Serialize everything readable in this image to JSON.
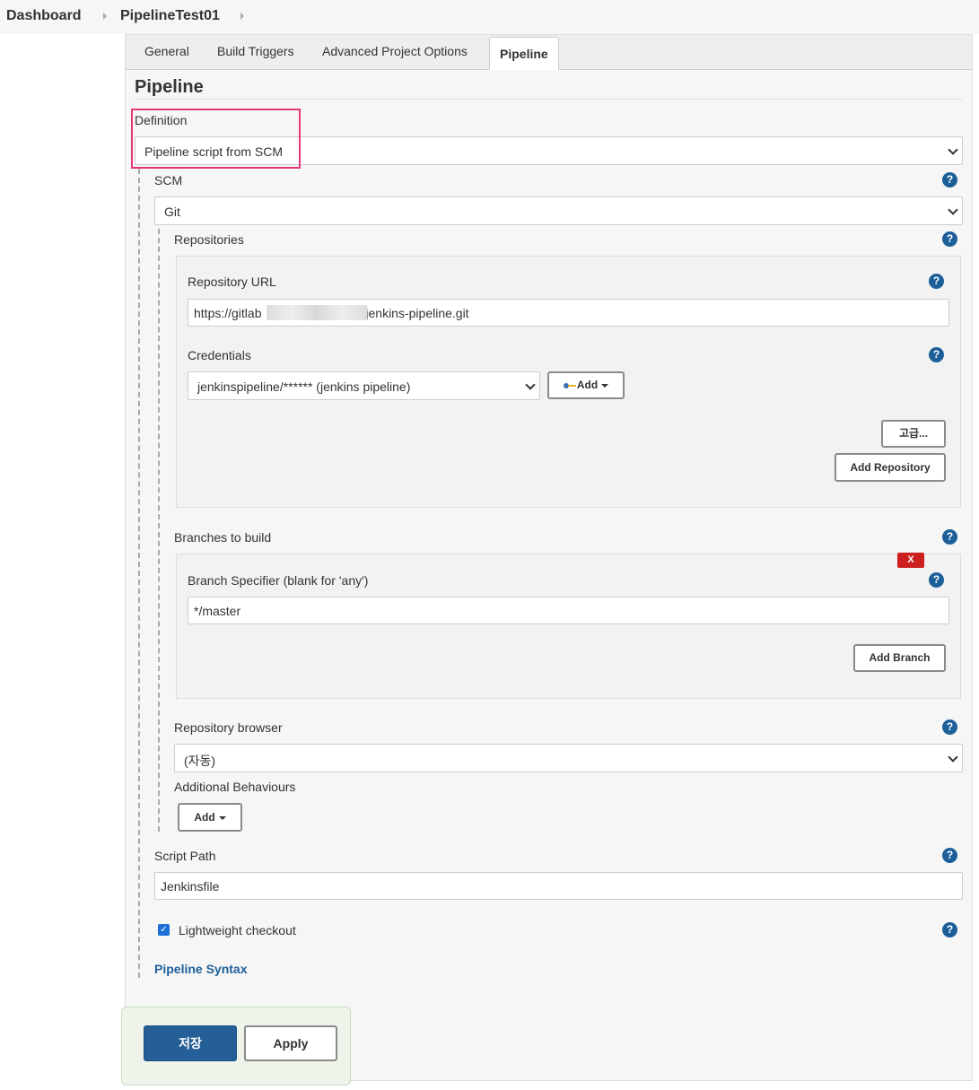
{
  "breadcrumb": {
    "items": [
      "Dashboard",
      "PipelineTest01"
    ]
  },
  "tabs": [
    "General",
    "Build Triggers",
    "Advanced Project Options",
    "Pipeline"
  ],
  "active_tab": "Pipeline",
  "section": {
    "title": "Pipeline"
  },
  "definition": {
    "label": "Definition",
    "value": "Pipeline script from SCM"
  },
  "scm": {
    "label": "SCM",
    "value": "Git"
  },
  "repositories": {
    "label": "Repositories",
    "url_label": "Repository URL",
    "url_prefix": "https://gitlab",
    "url_suffix": "/jenkins-pipeline.git",
    "credentials_label": "Credentials",
    "credentials_value": "jenkinspipeline/****** (jenkins pipeline)",
    "add_label": "Add",
    "advanced_label": "고급...",
    "add_repository_label": "Add Repository"
  },
  "branches": {
    "label": "Branches to build",
    "delete_label": "X",
    "specifier_label": "Branch Specifier (blank for 'any')",
    "specifier_value": "*/master",
    "add_branch_label": "Add Branch"
  },
  "repo_browser": {
    "label": "Repository browser",
    "value": "(자동)"
  },
  "behaviours": {
    "label": "Additional Behaviours",
    "add_label": "Add"
  },
  "script_path": {
    "label": "Script Path",
    "value": "Jenkinsfile"
  },
  "lightweight": {
    "label": "Lightweight checkout",
    "checked": true
  },
  "syntax_link": "Pipeline Syntax",
  "footer": {
    "save_label": "저장",
    "apply_label": "Apply"
  },
  "help_glyph": "?",
  "check_glyph": "✓",
  "colors": {
    "accent": "#245f97",
    "highlight": "#e6357a",
    "delete": "#cc1f1f"
  }
}
